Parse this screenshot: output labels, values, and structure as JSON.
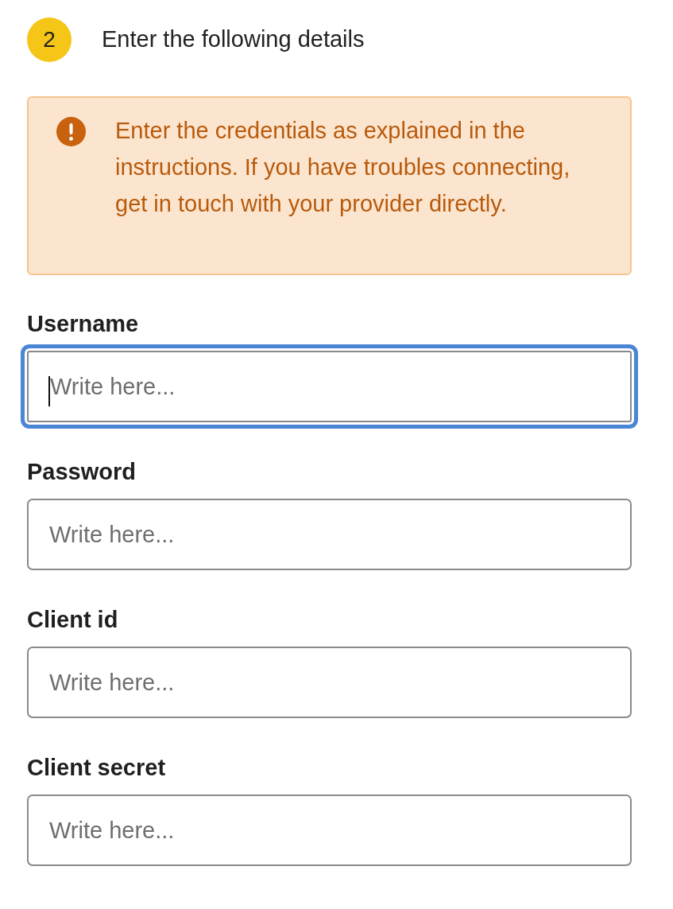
{
  "step": {
    "number": "2",
    "title": "Enter the following details"
  },
  "alert": {
    "text": "Enter the credentials as explained in the instructions. If you have troubles connecting, get in touch with your provider directly."
  },
  "fields": [
    {
      "label": "Username",
      "placeholder": "Write here...",
      "focused": true
    },
    {
      "label": "Password",
      "placeholder": "Write here...",
      "focused": false
    },
    {
      "label": "Client id",
      "placeholder": "Write here...",
      "focused": false
    },
    {
      "label": "Client secret",
      "placeholder": "Write here...",
      "focused": false
    }
  ]
}
